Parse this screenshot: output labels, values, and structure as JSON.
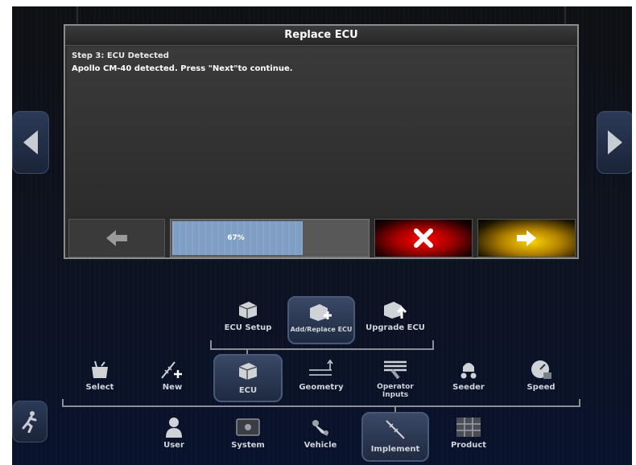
{
  "dialog": {
    "title": "Replace ECU",
    "step": "Step 3: ECU Detected",
    "message": "Apollo CM-40 detected. Press \"Next\"to continue.",
    "progress": {
      "value": 0.67,
      "label": "67%"
    }
  },
  "ecu_menu": [
    {
      "label": "ECU Setup",
      "icon": "ecu-setup-icon"
    },
    {
      "label": "Add/Replace ECU",
      "icon": "ecu-add-icon",
      "selected": true
    },
    {
      "label": "Upgrade ECU",
      "icon": "ecu-upgrade-icon"
    }
  ],
  "implement_menu": [
    {
      "label": "Select",
      "icon": "select-icon"
    },
    {
      "label": "New",
      "icon": "new-icon"
    },
    {
      "label": "ECU",
      "icon": "ecu-icon",
      "selected": true
    },
    {
      "label": "Geometry",
      "icon": "geometry-icon"
    },
    {
      "label": "Operator Inputs",
      "icon": "operator-inputs-icon"
    },
    {
      "label": "Seeder",
      "icon": "seeder-icon"
    },
    {
      "label": "Speed",
      "icon": "speed-icon"
    }
  ],
  "main_menu": [
    {
      "label": "User",
      "icon": "user-icon"
    },
    {
      "label": "System",
      "icon": "system-icon"
    },
    {
      "label": "Vehicle",
      "icon": "vehicle-icon"
    },
    {
      "label": "Implement",
      "icon": "implement-icon",
      "selected": true
    },
    {
      "label": "Product",
      "icon": "product-icon"
    }
  ],
  "colors": {
    "cancel": "#ff0000",
    "next": "#ffd500",
    "progress_fill": "#7f9ec4"
  }
}
